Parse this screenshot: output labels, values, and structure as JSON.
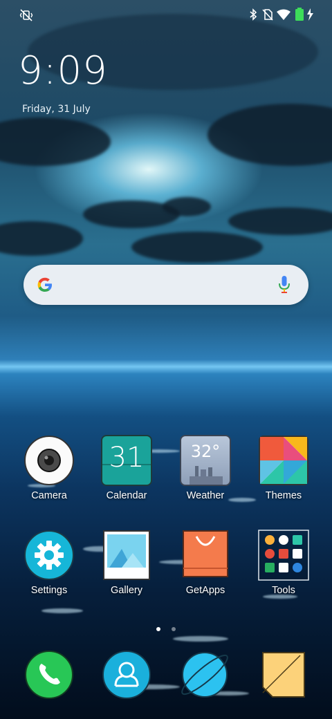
{
  "status_bar": {
    "left_icon": "vibrate-mute-icon",
    "right_icons": [
      "bluetooth-icon",
      "no-sim-icon",
      "wifi-icon",
      "battery-charging-icon"
    ],
    "battery_color": "#3ddc5a"
  },
  "lockscreen": {
    "time": "9:09",
    "date": "Friday, 31 July"
  },
  "search_bar": {
    "logo": "google-g-icon",
    "mic": "mic-icon"
  },
  "apps_row1": [
    {
      "label": "Camera",
      "icon": "camera-icon"
    },
    {
      "label": "Calendar",
      "icon": "calendar-icon",
      "day": "31"
    },
    {
      "label": "Weather",
      "icon": "weather-icon",
      "temp": "32°"
    },
    {
      "label": "Themes",
      "icon": "themes-icon"
    }
  ],
  "apps_row2": [
    {
      "label": "Settings",
      "icon": "gear-icon"
    },
    {
      "label": "Gallery",
      "icon": "gallery-icon"
    },
    {
      "label": "GetApps",
      "icon": "shopping-bag-icon"
    },
    {
      "label": "Tools",
      "icon": "folder-icon"
    }
  ],
  "page_indicator": {
    "current": 1,
    "total": 2
  },
  "dock": [
    "phone-icon",
    "contacts-icon",
    "browser-icon",
    "notes-icon"
  ],
  "colors": {
    "calendar": "#1aa39a",
    "settings": "#16b6d8",
    "getapps": "#f47b4c",
    "phone": "#28c756",
    "contacts": "#1ab0dc",
    "browser": "#2cc2f0",
    "notes": "#fcd27a"
  }
}
